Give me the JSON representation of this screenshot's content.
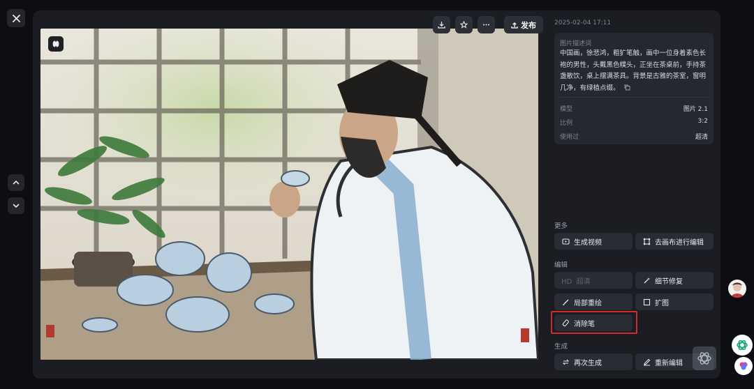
{
  "viewer": {
    "close_icon": "close-icon",
    "nav_up_icon": "chevron-up-icon",
    "nav_down_icon": "chevron-down-icon"
  },
  "toolbar": {
    "download_icon": "download-icon",
    "favorite_icon": "star-icon",
    "more_icon": "more-icon",
    "publish_label": "发布"
  },
  "image": {
    "subject": "Chinese ink painting of a scholar holding a teacup at a tea table"
  },
  "details": {
    "timestamp": "2025-02-04 17:11",
    "description_title": "图片描述词",
    "description": "中国画，徐悲鸿，粗犷笔触，画中一位身着素色长袍的男性，头戴黑色幞头，正坐在茶桌前，手持茶盏散饮，桌上摆满茶具。背景是古雅的茶室，窗明几净，有绿植点缀。",
    "meta": [
      {
        "key": "模型",
        "value": "图片 2.1"
      },
      {
        "key": "比例",
        "value": "3:2"
      },
      {
        "key": "使用过",
        "value": "超清"
      }
    ]
  },
  "sections": {
    "more": {
      "label": "更多",
      "buttons": [
        "生成视频",
        "去画布进行编辑"
      ]
    },
    "edit": {
      "label": "编辑",
      "buttons": [
        "HD  超清",
        "细节修复",
        "局部重绘",
        "扩图",
        "消除笔"
      ]
    },
    "generate": {
      "label": "生成",
      "buttons": [
        "再次生成",
        "重新编辑"
      ]
    }
  },
  "colors": {
    "background": "#0d0e12",
    "panel": "#1b1d22",
    "button": "#292c33",
    "highlight": "#d42a2a"
  }
}
